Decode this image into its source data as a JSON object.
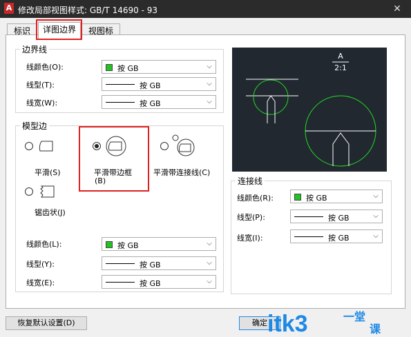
{
  "window": {
    "title": "修改局部视图样式: GB/T 14690 - 93",
    "close_glyph": "✕",
    "app_icon_letter": "A"
  },
  "tabs": [
    {
      "label": "标识符"
    },
    {
      "label": "详图边界"
    },
    {
      "label": "视图标签"
    }
  ],
  "boundary_group": {
    "title": "边界线",
    "color_label": "线颜色(O):",
    "color_value": "按 GB",
    "color_swatch": "#22c422",
    "linetype_label": "线型(T):",
    "linetype_value": "按 GB",
    "lineweight_label": "线宽(W):",
    "lineweight_value": "按 GB"
  },
  "model_edge_group": {
    "title": "模型边",
    "options": [
      {
        "label": "平滑(S)",
        "checked": false
      },
      {
        "label": "平滑带边框",
        "label_line2": "(B)",
        "checked": true
      },
      {
        "label": "平滑带连接线(C)",
        "checked": false
      },
      {
        "label": "锯齿状(J)",
        "checked": false
      }
    ],
    "color_label": "线颜色(L):",
    "color_value": "按 GB",
    "linetype_label": "线型(Y):",
    "linetype_value": "按 GB",
    "lineweight_label": "线宽(E):",
    "lineweight_value": "按 GB"
  },
  "preview": {
    "label_letter": "A",
    "label_scale": "2:1"
  },
  "connector_group": {
    "title": "连接线",
    "color_label": "线颜色(R):",
    "color_value": "按 GB",
    "linetype_label": "线型(P):",
    "linetype_value": "按 GB",
    "lineweight_label": "线宽(I):",
    "lineweight_value": "按 GB"
  },
  "buttons": {
    "restore_defaults": "恢复默认设置(D)",
    "ok": "确定"
  },
  "watermark": {
    "text": "itk3",
    "suffix_top": "一堂",
    "suffix_bottom": "课"
  },
  "colors": {
    "highlight": "#e02020",
    "preview_bg": "#212830",
    "preview_green": "#22dd22",
    "accent_blue": "#1e88e5"
  }
}
